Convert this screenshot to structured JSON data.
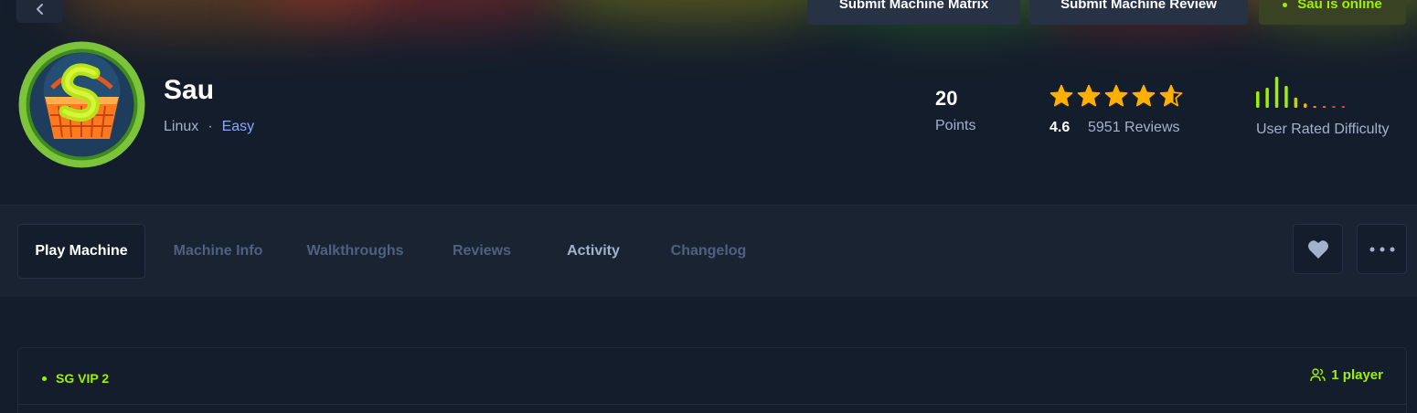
{
  "header": {
    "buttons": {
      "submit_matrix": "Submit Machine Matrix",
      "submit_review": "Submit Machine Review",
      "online_status": "Sau is online"
    }
  },
  "machine": {
    "name": "Sau",
    "os": "Linux",
    "separator": "·",
    "difficulty": "Easy"
  },
  "stats": {
    "points_value": "20",
    "points_label": "Points",
    "rating_value": "4.6",
    "rating_stars": 4.6,
    "reviews": "5951 Reviews",
    "difficulty_label": "User Rated Difficulty",
    "difficulty_distribution": [
      0.45,
      0.55,
      0.85,
      0.6,
      0.28,
      0.12,
      0.04,
      0.04,
      0.04,
      0.04
    ],
    "difficulty_colors": [
      "#9fef00",
      "#9fef00",
      "#9fef00",
      "#9fef00",
      "#c8d200",
      "#ffaf00",
      "#ff8a3c",
      "#ff5c4d",
      "#ff3e3e",
      "#ff3e3e"
    ]
  },
  "tabs": {
    "play": "Play Machine",
    "info": "Machine Info",
    "walkthroughs": "Walkthroughs",
    "reviews": "Reviews",
    "activity": "Activity",
    "changelog": "Changelog"
  },
  "server": {
    "name": "SG VIP 2",
    "players": "1 player"
  },
  "colors": {
    "background": "#141d2b",
    "panel": "#1a2332",
    "accent_green": "#9fef00",
    "muted_text": "#a4b1cd",
    "star": "#ffaf00",
    "difficulty_easy": "#8aa8ff"
  }
}
